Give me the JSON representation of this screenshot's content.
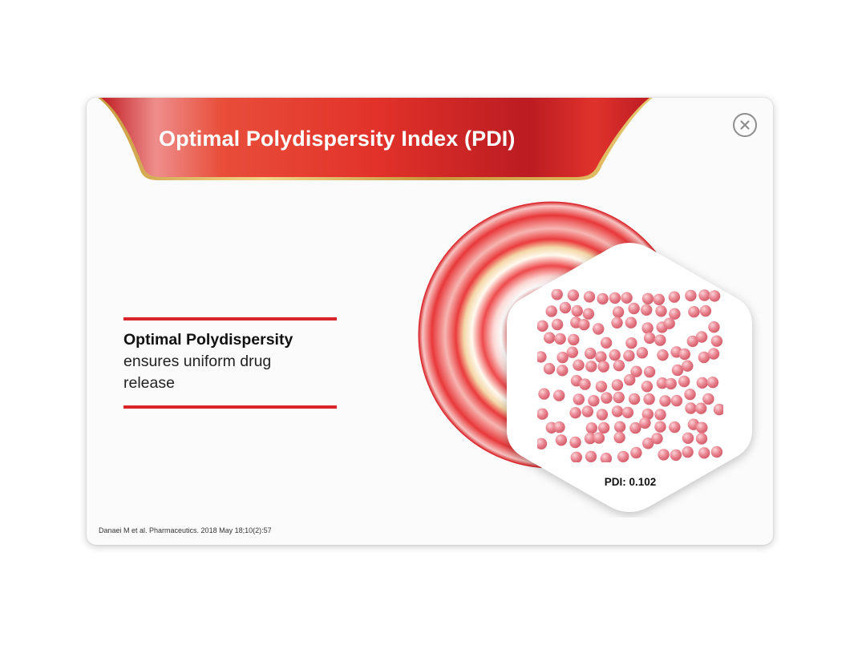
{
  "header": {
    "title": "Optimal Polydispersity Index (PDI)"
  },
  "close_icon": "close-icon",
  "callout": {
    "bold_text": "Optimal Polydispersity",
    "line2": "ensures uniform drug",
    "line3": "release"
  },
  "illustration": {
    "pdi_label": "PDI: 0.102",
    "particle_color": "#e6707d"
  },
  "footer": {
    "citation": "Danaei M et al. Pharmaceutics. 2018 May 18;10(2):57"
  },
  "colors": {
    "brand_red": "#d9252a",
    "banner_gold": "#d4a64a"
  }
}
